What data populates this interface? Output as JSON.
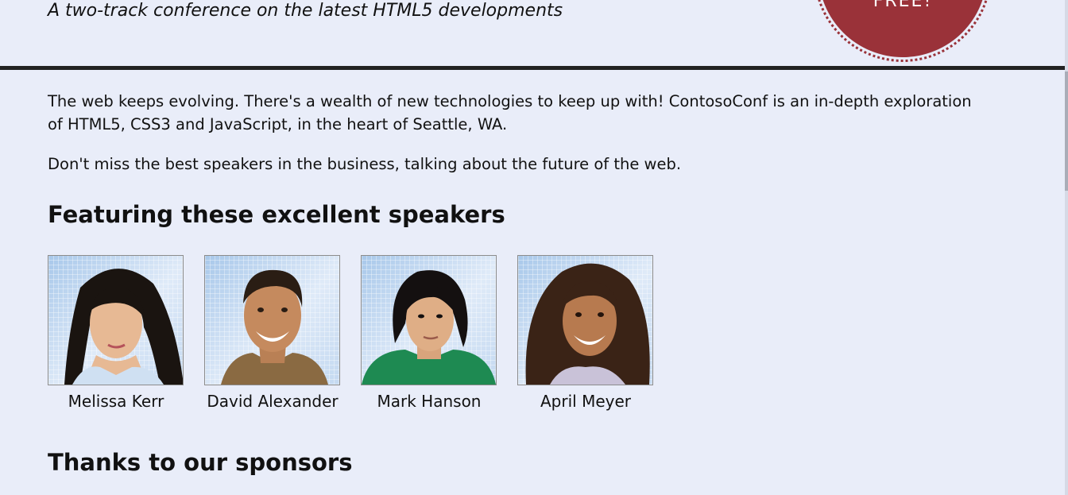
{
  "header": {
    "tagline": "A two-track conference on the latest HTML5 developments",
    "badge_text": "FREE!"
  },
  "intro": {
    "paragraph1": "The web keeps evolving. There's a wealth of new technologies to keep up with! ContosoConf is an in-depth exploration of HTML5, CSS3 and JavaScript, in the heart of Seattle, WA.",
    "paragraph2": "Don't miss the best speakers in the business, talking about the future of the web."
  },
  "speakers_section": {
    "heading": "Featuring these excellent speakers",
    "speakers": [
      {
        "name": "Melissa Kerr"
      },
      {
        "name": "David Alexander"
      },
      {
        "name": "Mark Hanson"
      },
      {
        "name": "April Meyer"
      }
    ]
  },
  "sponsors_section": {
    "heading": "Thanks to our sponsors"
  },
  "colors": {
    "background": "#e9edf9",
    "badge": "#9a3239",
    "rule": "#222222"
  }
}
